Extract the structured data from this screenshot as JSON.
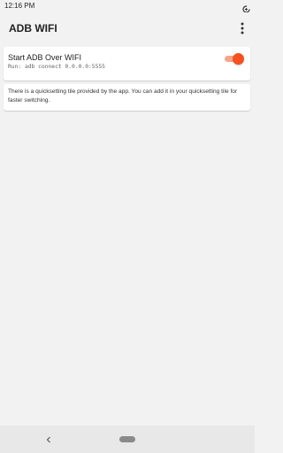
{
  "status_bar": {
    "time": "12:16 PM",
    "icon": "data-saver-icon"
  },
  "app_bar": {
    "title": "ADB WIFI",
    "overflow_icon": "more-vert-icon"
  },
  "toggle_card": {
    "title": "Start ADB Over WIFI",
    "subtitle": "Run: adb connect 0.0.0.0:5555",
    "switch_on": true
  },
  "info_card": {
    "text": "There is a quicksetting tile provided by the app. You can add it in your quicksetting tile for faster switching."
  },
  "nav_bar": {
    "back_icon": "back-chevron-icon",
    "home_icon": "home-pill-icon"
  },
  "colors": {
    "accent": "#f4511e",
    "accent_track": "#f7a58b",
    "background": "#f2f2f2",
    "card": "#ffffff"
  }
}
